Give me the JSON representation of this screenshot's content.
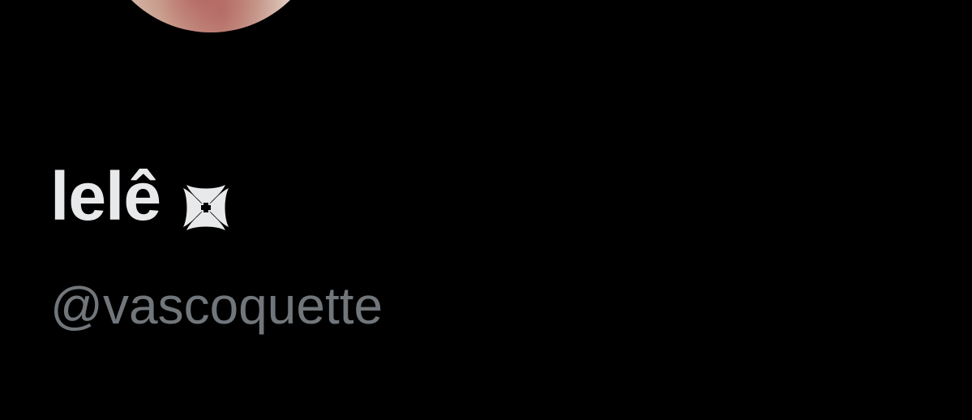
{
  "profile": {
    "display_name": "lelê",
    "handle": "@vascoquette",
    "badge_icon": "cross-pattee-icon",
    "avatar_icon": "avatar-image"
  },
  "colors": {
    "background": "#000000",
    "name": "#e7e9ea",
    "handle": "#71767b"
  }
}
